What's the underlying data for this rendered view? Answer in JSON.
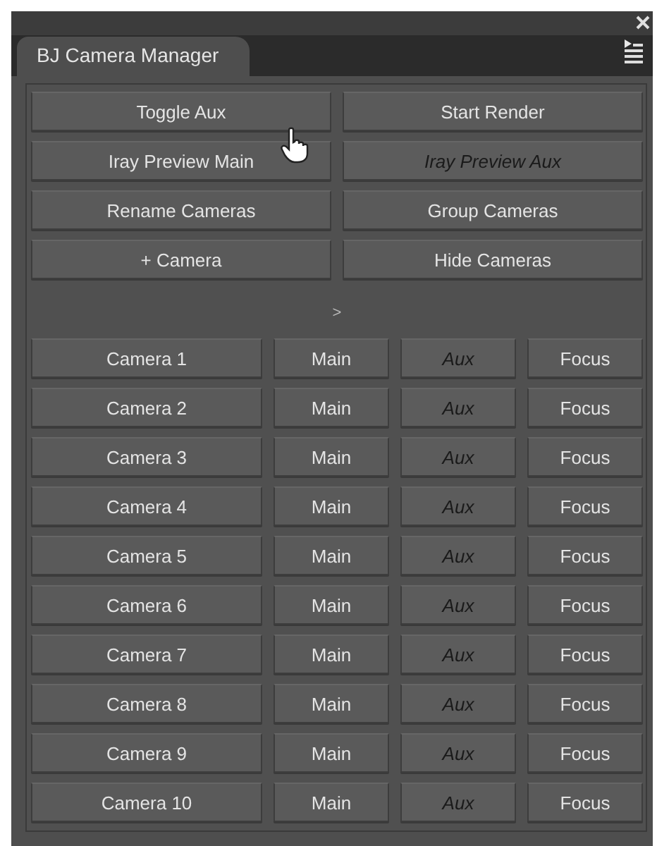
{
  "panel": {
    "tab": "BJ Camera Manager"
  },
  "actions": [
    {
      "label": "Toggle Aux",
      "disabled": false
    },
    {
      "label": "Start Render",
      "disabled": false
    },
    {
      "label": "Iray Preview Main",
      "disabled": false
    },
    {
      "label": "Iray Preview Aux",
      "disabled": true
    },
    {
      "label": "Rename Cameras",
      "disabled": false
    },
    {
      "label": "Group Cameras",
      "disabled": false
    },
    {
      "label": "+ Camera",
      "disabled": false
    },
    {
      "label": "Hide Cameras",
      "disabled": false
    }
  ],
  "expander": ">",
  "cameras": [
    {
      "name": "Camera 1",
      "main": "Main",
      "aux": "Aux",
      "aux_disabled": true,
      "focus": "Focus"
    },
    {
      "name": "Camera 2",
      "main": "Main",
      "aux": "Aux",
      "aux_disabled": true,
      "focus": "Focus"
    },
    {
      "name": "Camera 3",
      "main": "Main",
      "aux": "Aux",
      "aux_disabled": true,
      "focus": "Focus"
    },
    {
      "name": "Camera 4",
      "main": "Main",
      "aux": "Aux",
      "aux_disabled": true,
      "focus": "Focus"
    },
    {
      "name": "Camera 5",
      "main": "Main",
      "aux": "Aux",
      "aux_disabled": true,
      "focus": "Focus"
    },
    {
      "name": "Camera 6",
      "main": "Main",
      "aux": "Aux",
      "aux_disabled": true,
      "focus": "Focus"
    },
    {
      "name": "Camera 7",
      "main": "Main",
      "aux": "Aux",
      "aux_disabled": true,
      "focus": "Focus"
    },
    {
      "name": "Camera 8",
      "main": "Main",
      "aux": "Aux",
      "aux_disabled": true,
      "focus": "Focus"
    },
    {
      "name": "Camera 9",
      "main": "Main",
      "aux": "Aux",
      "aux_disabled": true,
      "focus": "Focus"
    },
    {
      "name": "Camera 10",
      "main": "Main",
      "aux": "Aux",
      "aux_disabled": true,
      "focus": "Focus"
    }
  ]
}
